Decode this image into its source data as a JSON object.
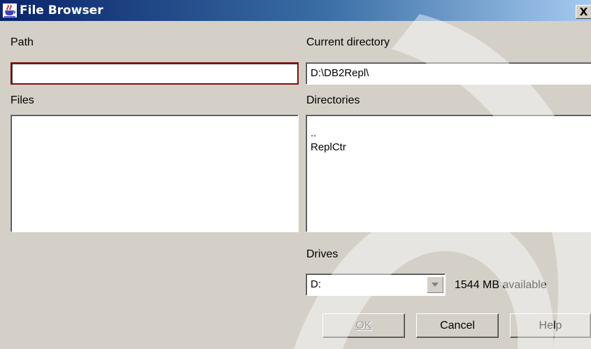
{
  "window": {
    "title": "File Browser",
    "close_label": "X",
    "icon": "java-cup-icon"
  },
  "path": {
    "label": "Path",
    "value": ""
  },
  "current_directory": {
    "label": "Current directory",
    "value": "D:\\DB2Repl\\"
  },
  "files": {
    "label": "Files",
    "items": []
  },
  "directories": {
    "label": "Directories",
    "items": [
      "..",
      "ReplCtr"
    ]
  },
  "drives": {
    "label": "Drives",
    "selected": "D:",
    "available": "1544 MB available"
  },
  "buttons": {
    "ok": "OK",
    "cancel": "Cancel",
    "help": "Help"
  },
  "colors": {
    "dialog_bg": "#d4d0c8",
    "title_start": "#0a246a",
    "title_end": "#a6caf0",
    "focus_border": "#7a1010"
  }
}
